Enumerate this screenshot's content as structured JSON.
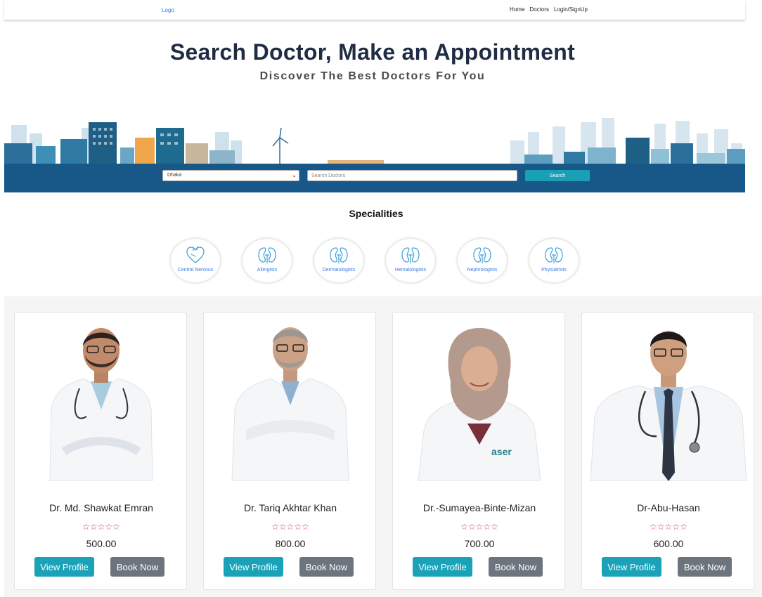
{
  "nav": {
    "logo": "Logo",
    "links": [
      "Home",
      "Doctors",
      "Login/SignUp"
    ]
  },
  "hero": {
    "title": "Search Doctor, Make an Appointment",
    "subtitle": "Discover The Best Doctors For You"
  },
  "search": {
    "city_selected": "Dhaka",
    "placeholder": "Search Doctors",
    "button_label": "Search"
  },
  "specialities": {
    "title": "Specialities",
    "items": [
      {
        "label": "Central Nervous",
        "icon": "heart-icon"
      },
      {
        "label": "Allergists",
        "icon": "kidney-icon"
      },
      {
        "label": "Dermatologists",
        "icon": "kidney-icon"
      },
      {
        "label": "Hematologists",
        "icon": "kidney-icon"
      },
      {
        "label": "Nephrologists",
        "icon": "kidney-icon"
      },
      {
        "label": "Physiatrists",
        "icon": "kidney-icon"
      }
    ]
  },
  "doctors": [
    {
      "name": "Dr. Md. Shawkat Emran",
      "rating": "☆☆☆☆☆",
      "fee": "500.00",
      "view_label": "View Profile",
      "book_label": "Book Now"
    },
    {
      "name": "Dr. Tariq Akhtar Khan",
      "rating": "☆☆☆☆☆",
      "fee": "800.00",
      "view_label": "View Profile",
      "book_label": "Book Now"
    },
    {
      "name": "Dr.-Sumayea-Binte-Mizan",
      "rating": "☆☆☆☆☆",
      "fee": "700.00",
      "view_label": "View Profile",
      "book_label": "Book Now"
    },
    {
      "name": "Dr-Abu-Hasan",
      "rating": "☆☆☆☆☆",
      "fee": "600.00",
      "view_label": "View Profile",
      "book_label": "Book Now"
    }
  ],
  "colors": {
    "band": "#185889",
    "accent": "#1aa0b5",
    "book_button": "#6c757d",
    "stars": "#c94a4a",
    "link": "#3d7be0"
  }
}
